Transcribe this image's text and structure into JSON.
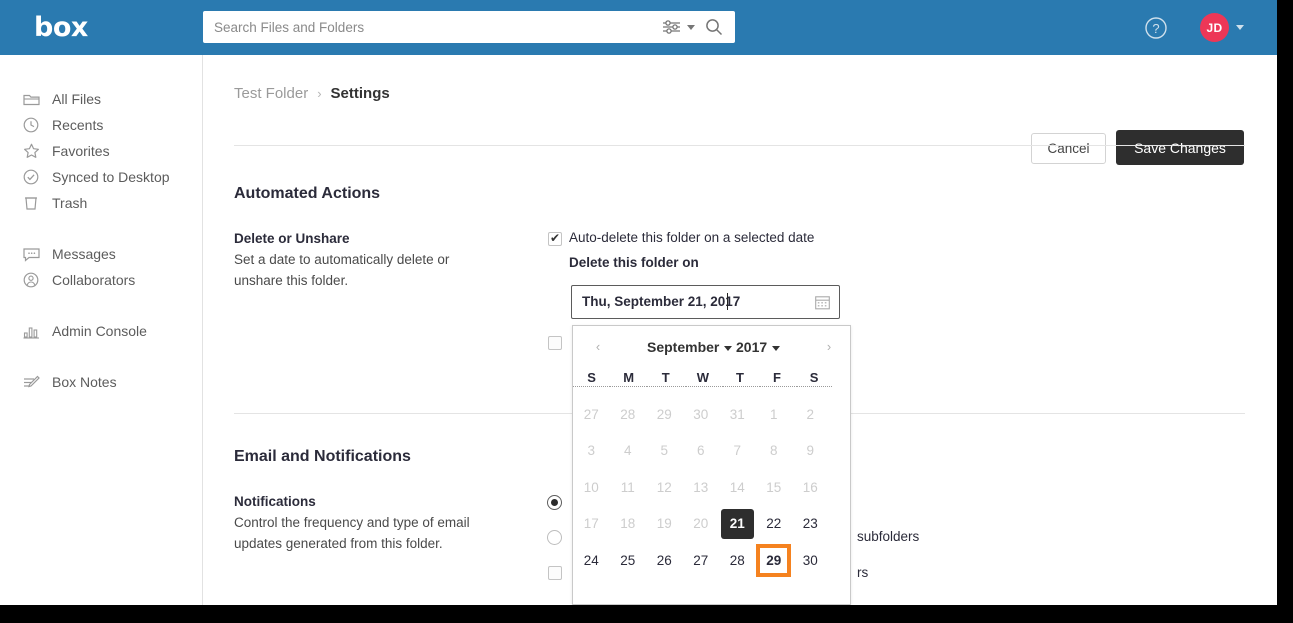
{
  "topbar": {
    "logo": "box",
    "search_placeholder": "Search Files and Folders",
    "search_value": "",
    "filter_icon": "filter-sliders-icon",
    "search_icon": "magnifying-glass-icon",
    "help_icon": "question-mark-circle-icon",
    "avatar_initials": "JD",
    "avatar_color": "#ed3757",
    "bar_color": "#2a7ab0"
  },
  "sidebar": {
    "items": [
      {
        "label": "All Files",
        "icon": "folder-icon"
      },
      {
        "label": "Recents",
        "icon": "clock-icon"
      },
      {
        "label": "Favorites",
        "icon": "star-icon"
      },
      {
        "label": "Synced to Desktop",
        "icon": "check-circle-icon"
      },
      {
        "label": "Trash",
        "icon": "trash-icon"
      },
      {
        "label": "Messages",
        "icon": "message-bubble-icon"
      },
      {
        "label": "Collaborators",
        "icon": "person-circle-icon"
      },
      {
        "label": "Admin Console",
        "icon": "bar-chart-icon"
      },
      {
        "label": "Box Notes",
        "icon": "note-pencil-icon"
      }
    ]
  },
  "breadcrumb": {
    "parent": "Test Folder",
    "separator": "›",
    "current": "Settings"
  },
  "actions": {
    "cancel": "Cancel",
    "save": "Save Changes"
  },
  "automated_actions": {
    "section_title": "Automated Actions",
    "row_label": "Delete or Unshare",
    "row_desc": "Set a date to automatically delete or unshare this folder.",
    "checkbox_label": "Auto-delete this folder on a selected date",
    "checkbox_checked": true,
    "date_label": "Delete this folder on",
    "date_value": "Thu, September 21, 2017",
    "date_icon": "calendar-icon",
    "second_checkbox_checked": false
  },
  "datepicker": {
    "prev_arrow": "‹",
    "next_arrow": "›",
    "month": "September",
    "year": "2017",
    "weekdays": [
      "S",
      "M",
      "T",
      "W",
      "T",
      "F",
      "S"
    ],
    "weeks": [
      [
        {
          "d": "27",
          "state": "muted"
        },
        {
          "d": "28",
          "state": "muted"
        },
        {
          "d": "29",
          "state": "muted"
        },
        {
          "d": "30",
          "state": "muted"
        },
        {
          "d": "31",
          "state": "muted"
        },
        {
          "d": "1",
          "state": "muted"
        },
        {
          "d": "2",
          "state": "muted"
        }
      ],
      [
        {
          "d": "3",
          "state": "muted"
        },
        {
          "d": "4",
          "state": "muted"
        },
        {
          "d": "5",
          "state": "muted"
        },
        {
          "d": "6",
          "state": "muted"
        },
        {
          "d": "7",
          "state": "muted"
        },
        {
          "d": "8",
          "state": "muted"
        },
        {
          "d": "9",
          "state": "muted"
        }
      ],
      [
        {
          "d": "10",
          "state": "muted"
        },
        {
          "d": "11",
          "state": "muted"
        },
        {
          "d": "12",
          "state": "muted"
        },
        {
          "d": "13",
          "state": "muted"
        },
        {
          "d": "14",
          "state": "muted"
        },
        {
          "d": "15",
          "state": "muted"
        },
        {
          "d": "16",
          "state": "muted"
        }
      ],
      [
        {
          "d": "17",
          "state": "muted"
        },
        {
          "d": "18",
          "state": "muted"
        },
        {
          "d": "19",
          "state": "muted"
        },
        {
          "d": "20",
          "state": "muted"
        },
        {
          "d": "21",
          "state": "selected"
        },
        {
          "d": "22",
          "state": "normal"
        },
        {
          "d": "23",
          "state": "normal"
        }
      ],
      [
        {
          "d": "24",
          "state": "normal"
        },
        {
          "d": "25",
          "state": "normal"
        },
        {
          "d": "26",
          "state": "normal"
        },
        {
          "d": "27",
          "state": "normal"
        },
        {
          "d": "28",
          "state": "normal"
        },
        {
          "d": "29",
          "state": "highlighted"
        },
        {
          "d": "30",
          "state": "normal"
        }
      ]
    ],
    "highlight_color": "#f5821f",
    "selected_color": "#2e2e2e"
  },
  "email_notifications": {
    "section_title": "Email and Notifications",
    "row_label": "Notifications",
    "row_desc": "Control the frequency and type of email updates generated from this folder.",
    "options": [
      {
        "text": "",
        "type": "radio",
        "selected": true
      },
      {
        "text": "subfolders",
        "type": "radio",
        "selected": false
      },
      {
        "text": "rs",
        "type": "checkbox",
        "selected": false
      }
    ]
  }
}
